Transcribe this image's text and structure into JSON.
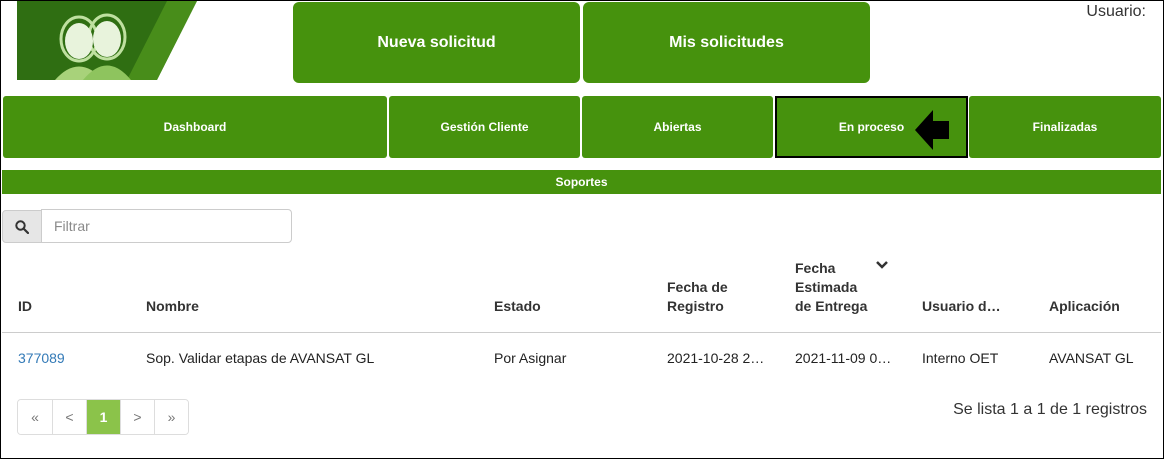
{
  "top_buttons": {
    "new_request": "Nueva solicitud",
    "my_requests": "Mis solicitudes"
  },
  "user_label": "Usuario:",
  "nav": [
    {
      "label": "Dashboard"
    },
    {
      "label": "Gestión Cliente"
    },
    {
      "label": "Abiertas"
    },
    {
      "label": "En proceso"
    },
    {
      "label": "Finalizadas"
    }
  ],
  "section_title": "Soportes",
  "search": {
    "placeholder": "Filtrar"
  },
  "columns": {
    "id": "ID",
    "nombre": "Nombre",
    "estado": "Estado",
    "fecha_registro": [
      "Fecha de",
      "Registro"
    ],
    "fecha_entrega": [
      "Fecha",
      "Estimada",
      "de Entrega"
    ],
    "usuario": "Usuario d…",
    "aplicacion": "Aplicación"
  },
  "rows": [
    {
      "id": "377089",
      "nombre": "Sop. Validar etapas de AVANSAT GL",
      "estado": "Por Asignar",
      "fecha_registro": "2021-10-28 2…",
      "fecha_entrega": "2021-11-09 0…",
      "usuario": "Interno OET",
      "aplicacion": "AVANSAT GL"
    }
  ],
  "pagination": {
    "first": "«",
    "prev": "<",
    "current": "1",
    "next": ">",
    "last": "»"
  },
  "summary": "Se lista 1 a 1 de 1 registros",
  "colors": {
    "brand_green": "#46920d",
    "active_page": "#8bc34a",
    "link": "#337ab7"
  }
}
